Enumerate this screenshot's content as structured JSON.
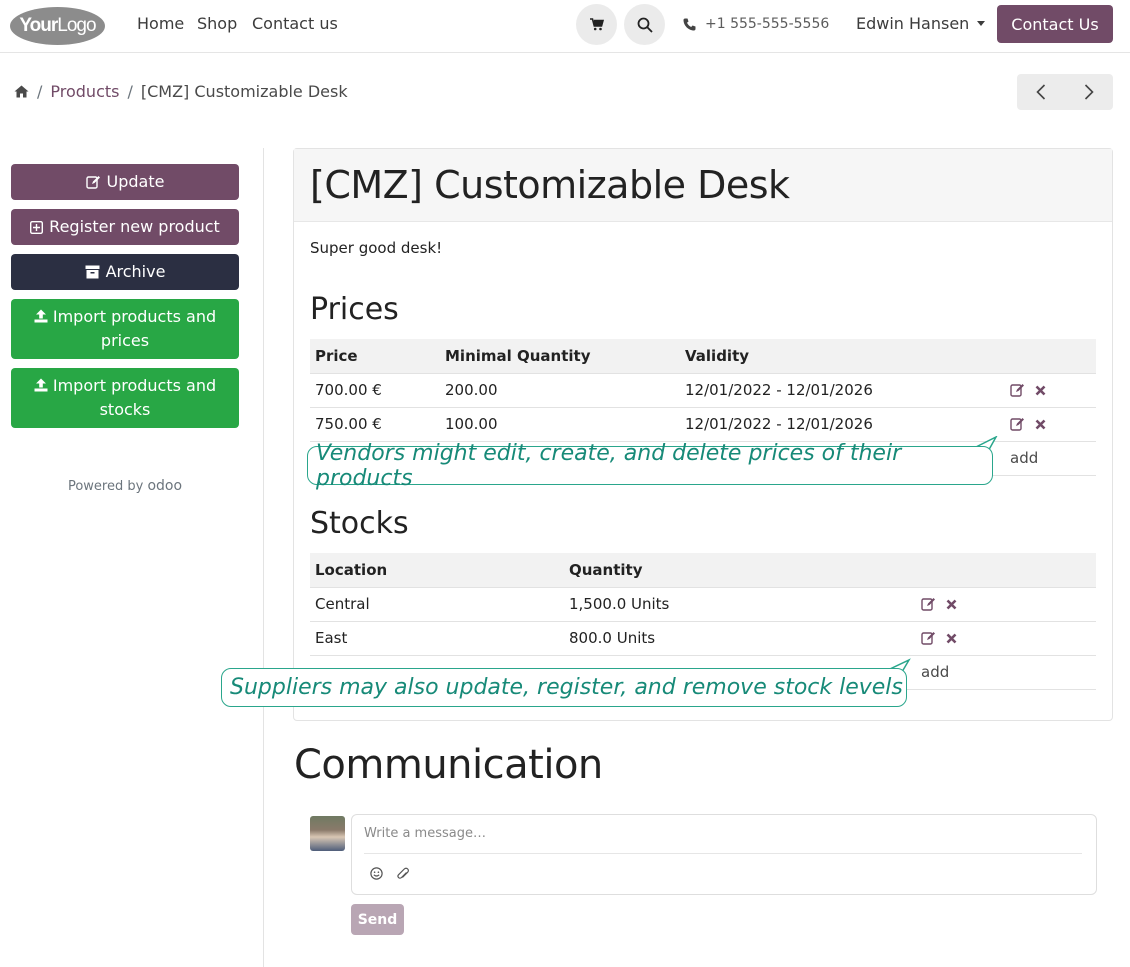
{
  "nav": {
    "logo_bold": "Your",
    "logo_rest": "Logo",
    "links": [
      "Home",
      "Shop",
      "Contact us"
    ],
    "phone": "+1 555-555-5556",
    "user": "Edwin Hansen",
    "contact_button": "Contact Us"
  },
  "breadcrumb": {
    "products": "Products",
    "current": "[CMZ] Customizable Desk"
  },
  "sidebar": {
    "update": "Update",
    "register": "Register new product",
    "archive": "Archive",
    "import_prices": "Import products and prices",
    "import_stocks": "Import products and stocks",
    "powered_by": "Powered by",
    "odoo": "odoo"
  },
  "product": {
    "title": "[CMZ] Customizable Desk",
    "description": "Super good desk!"
  },
  "prices": {
    "heading": "Prices",
    "columns": [
      "Price",
      "Minimal Quantity",
      "Validity"
    ],
    "rows": [
      [
        "700.00 €",
        "200.00",
        "12/01/2022 - 12/01/2026"
      ],
      [
        "750.00 €",
        "100.00",
        "12/01/2022 - 12/01/2026"
      ]
    ],
    "add": "add"
  },
  "stocks": {
    "heading": "Stocks",
    "columns": [
      "Location",
      "Quantity"
    ],
    "rows": [
      [
        "Central",
        "1,500.0 Units"
      ],
      [
        "East",
        "800.0 Units"
      ]
    ],
    "add": "add"
  },
  "callouts": {
    "prices": "Vendors might edit, create, and delete prices of their products",
    "stocks": "Suppliers may also update, register, and remove stock levels"
  },
  "communication": {
    "title": "Communication",
    "placeholder": "Write a message…",
    "send": "Send"
  },
  "colors": {
    "brand": "#714b67",
    "dark": "#2b2f42",
    "green": "#28a745",
    "callout": "#2aa68c"
  }
}
